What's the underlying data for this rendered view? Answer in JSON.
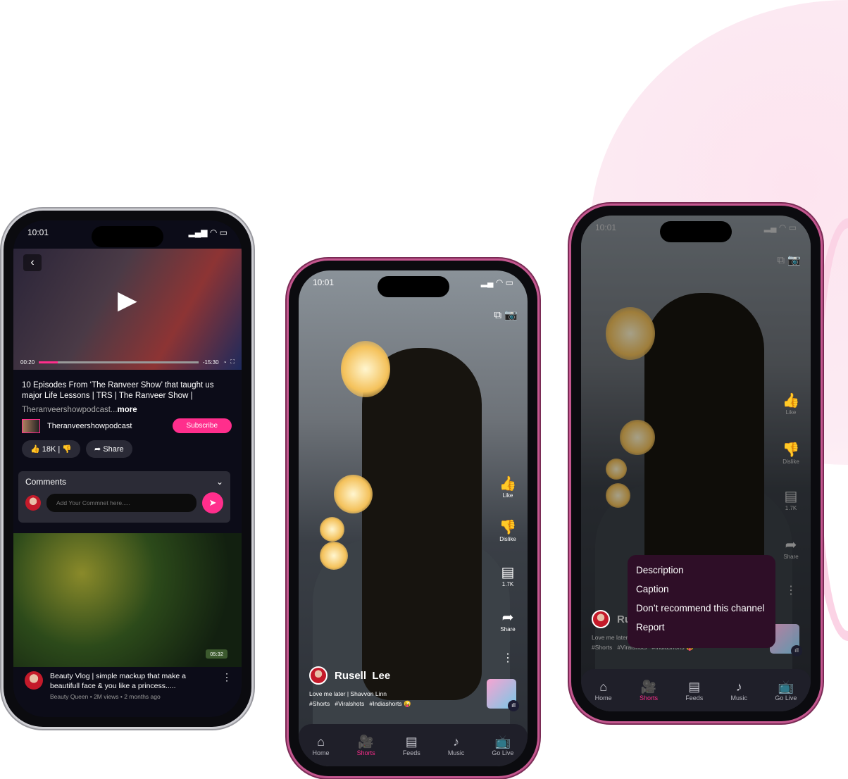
{
  "colors": {
    "accent": "#ff2e8c",
    "menu_bg": "#2e0e27",
    "nav_bg": "#1f1f29"
  },
  "status": {
    "time": "10:01"
  },
  "video_screen": {
    "player": {
      "elapsed": "00:20",
      "remaining": "-15:30",
      "progress_percent": 12
    },
    "title": "10 Episodes From ‘The Ranveer Show’ that taught us major Life Lessons | TRS | The Ranveer Show |",
    "channel_desc": "Theranveershowpodcast...",
    "more": "more",
    "channel": "Theranveershowpodcast",
    "subscribe": "Subscribe",
    "likes": "18K",
    "share": "Share",
    "comments": {
      "label": "Comments",
      "placeholder": "Add Your Commnet here....."
    },
    "next_video": {
      "duration": "05:32",
      "title": "Beauty Vlog | simple mackup that make a beautifull face & you like a princess.....",
      "channel": "Beauty Queen",
      "views": "2M views",
      "age": "2 months ago"
    }
  },
  "shorts": {
    "actions": {
      "like": "Like",
      "dislike": "Dislike",
      "comments": "1.7K",
      "share": "Share"
    },
    "user": "Rusell  Lee",
    "song": "Love me later | Shavvon Linn",
    "tags": "#Shorts   #Viralshots   #Indiashorts 😜"
  },
  "menu": [
    "Description",
    "Caption",
    "Don’t recommend this channel",
    "Report"
  ],
  "nav": [
    {
      "label": "Home",
      "icon": "home-icon"
    },
    {
      "label": "Shorts",
      "icon": "video-camera-icon",
      "active": true
    },
    {
      "label": "Feeds",
      "icon": "document-icon"
    },
    {
      "label": "Music",
      "icon": "music-note-icon"
    },
    {
      "label": "Go Live",
      "icon": "tv-icon"
    }
  ]
}
